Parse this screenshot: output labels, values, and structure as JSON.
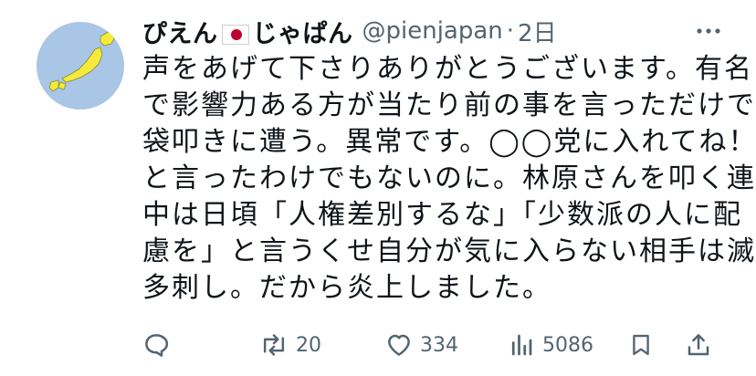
{
  "tweet": {
    "display_name_prefix": "ぴえん",
    "display_name_suffix": "じゃぱん",
    "flag_icon": "japan-flag-emoji",
    "handle": "@pienjapan",
    "separator": "·",
    "time": "2日",
    "more_icon": "more-horizontal-icon",
    "lines": [
      "声をあげて下さりありがとうございます。有名",
      "で影響力ある方が当たり前の事を言っただけで",
      "袋叩きに遭う。異常です。◯◯党に入れてね！",
      "と言ったわけでもないのに。林原さんを叩く連",
      "中は日頃「人権差別するな」「少数派の人に配",
      "慮を」と言うくせ自分が気に入らない相手は滅",
      "多刺し。だから炎上しました。"
    ]
  },
  "actions": {
    "reply_icon": "reply-icon",
    "retweet_icon": "retweet-icon",
    "retweet_count": "20",
    "like_icon": "heart-icon",
    "like_count": "334",
    "views_icon": "views-chart-icon",
    "views_count": "5086",
    "bookmark_icon": "bookmark-icon",
    "share_icon": "share-icon"
  },
  "colors": {
    "text": "#0f1419",
    "secondary": "#536471",
    "avatar_bg": "#a9c6e6",
    "avatar_map": "#f3ea3b",
    "flag_red": "#bc002d"
  }
}
